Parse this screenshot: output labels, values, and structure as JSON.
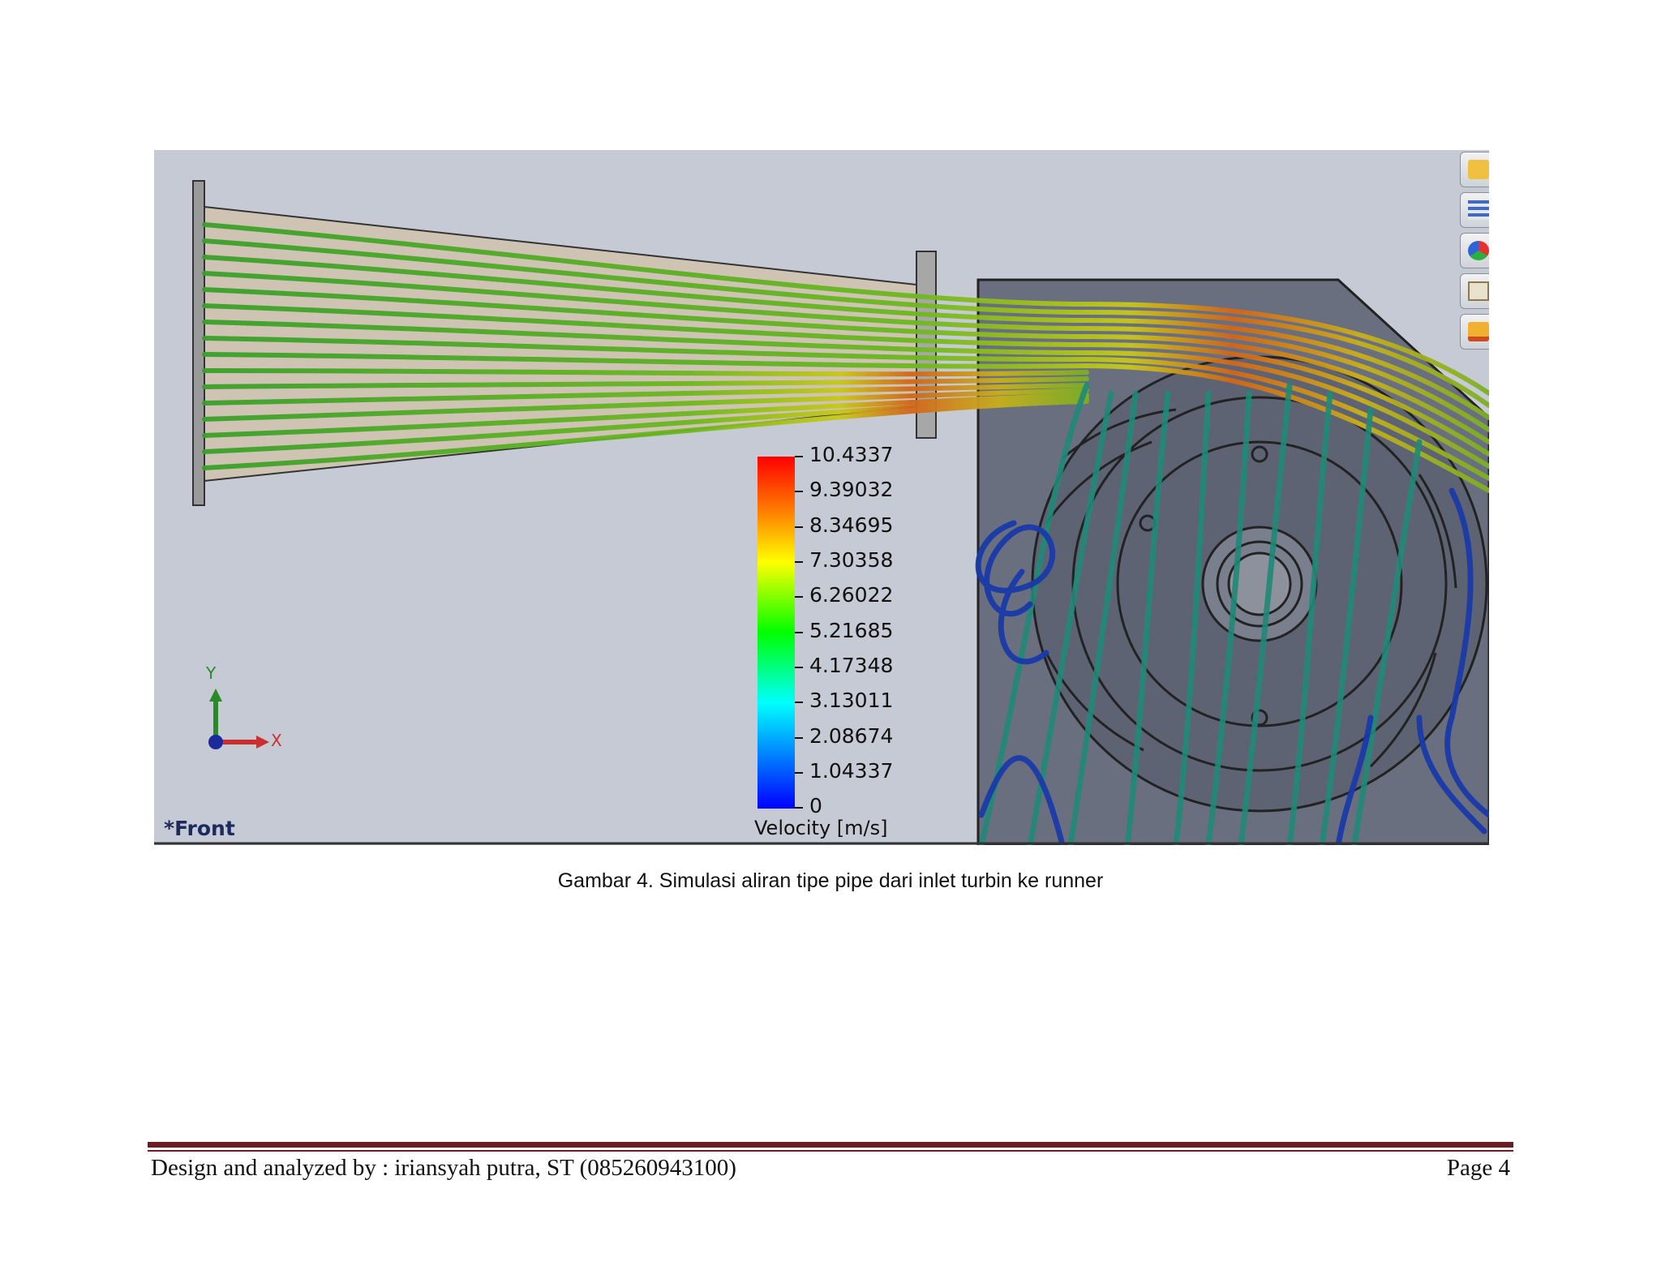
{
  "figure": {
    "legend": {
      "title": "Velocity [m/s]",
      "values": [
        "10.4337",
        "9.39032",
        "8.34695",
        "7.30358",
        "6.26022",
        "5.21685",
        "4.17348",
        "3.13011",
        "2.08674",
        "1.04337",
        "0"
      ]
    },
    "view_label": "*Front",
    "axes": {
      "y": "Y",
      "x": "X"
    },
    "toolbar_icons": [
      "folder-icon",
      "list-icon",
      "color-ball-icon",
      "clipboard-icon",
      "folder-open-icon"
    ]
  },
  "caption": "Gambar 4. Simulasi aliran tipe pipe dari inlet turbin ke runner",
  "footer": {
    "credit": "Design and analyzed by : iriansyah putra, ST (085260943100)",
    "page": "Page 4"
  }
}
